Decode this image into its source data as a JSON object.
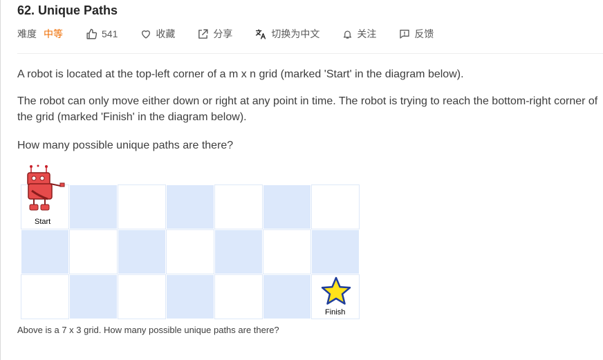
{
  "problem": {
    "title": "62. Unique Paths"
  },
  "meta": {
    "difficulty_label": "难度",
    "difficulty_value": "中等",
    "likes": "541",
    "favorite_label": "收藏",
    "share_label": "分享",
    "translate_label": "切换为中文",
    "follow_label": "关注",
    "feedback_label": "反馈",
    "difficulty_color": "#ef6c00"
  },
  "content": {
    "p1": "A robot is located at the top-left corner of a m x n grid (marked 'Start' in the diagram below).",
    "p2": "The robot can only move either down or right at any point in time. The robot is trying to reach the bottom-right corner of the grid (marked 'Finish' in the diagram below).",
    "p3": "How many possible unique paths are there?"
  },
  "diagram": {
    "start_label": "Start",
    "finish_label": "Finish",
    "caption": "Above is a 7 x 3 grid. How many possible unique paths are there?",
    "cell_blue": "#dce8fb",
    "star_color": "#ffe31a"
  }
}
